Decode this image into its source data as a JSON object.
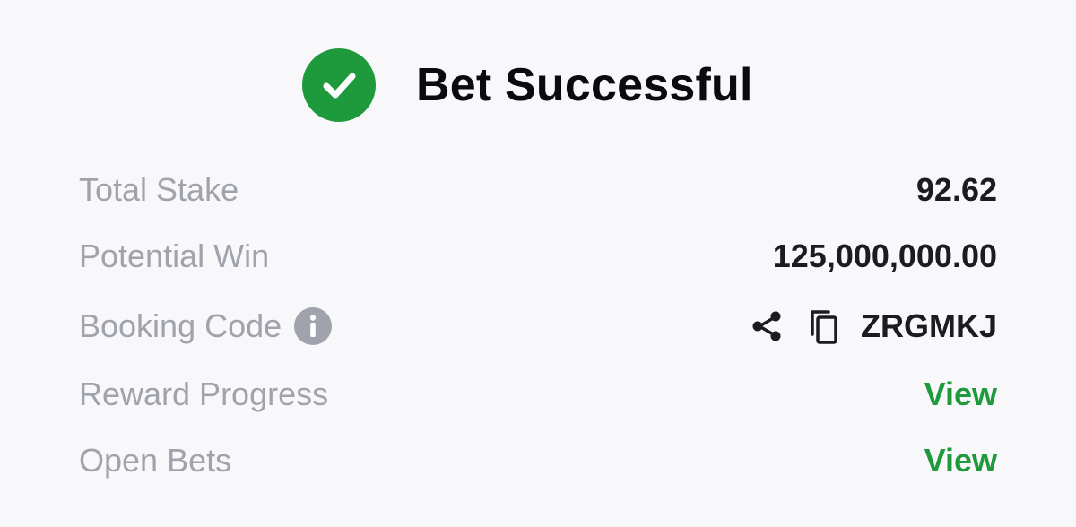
{
  "header": {
    "title": "Bet Successful",
    "icon": "check-circle-icon",
    "accent_color": "#1e9a3c"
  },
  "summary": {
    "total_stake": {
      "label": "Total Stake",
      "value": "92.62"
    },
    "potential_win": {
      "label": "Potential Win",
      "value": "125,000,000.00"
    },
    "booking_code": {
      "label": "Booking Code",
      "label_icon": "info-icon",
      "value": "ZRGMKJ",
      "actions": [
        "share-icon",
        "copy-icon"
      ]
    },
    "reward_progress": {
      "label": "Reward Progress",
      "link": "View"
    },
    "open_bets": {
      "label": "Open Bets",
      "link": "View"
    }
  },
  "colors": {
    "label_gray": "#a1a3ac",
    "value_dark": "#1b1c20",
    "link_green": "#1e9a3c",
    "background": "#f8f8fa"
  }
}
